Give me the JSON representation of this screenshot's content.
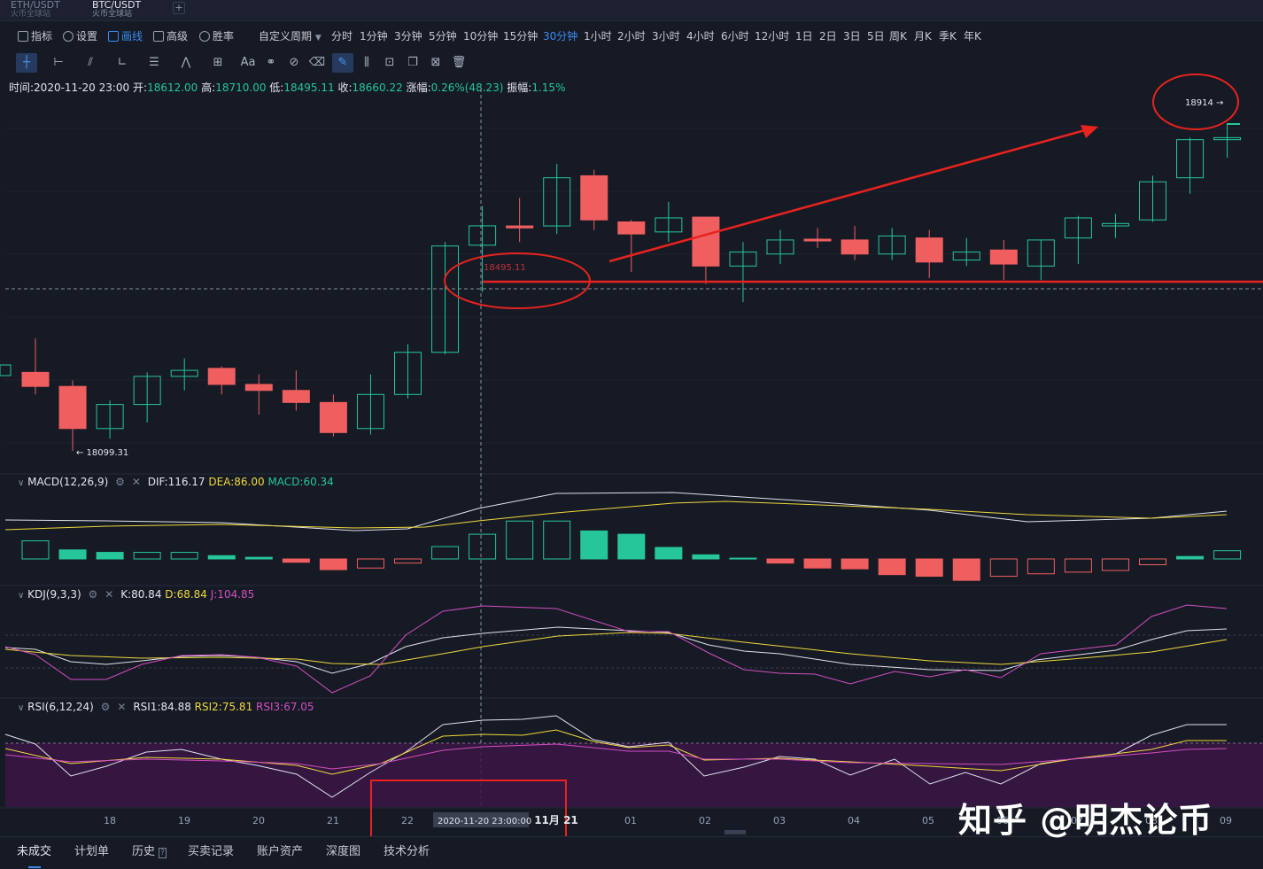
{
  "tabs": [
    {
      "pair": "ETH/USDT",
      "exchange": "火币全球站",
      "active": false
    },
    {
      "pair": "BTC/USDT",
      "exchange": "火币全球站",
      "active": true
    }
  ],
  "tab_add": "+",
  "toolbar": {
    "indicators": "指标",
    "settings": "设置",
    "draw": "画线",
    "advanced": "高级",
    "win_rate": "胜率",
    "custom_period": "自定义周期"
  },
  "periods": [
    "分时",
    "1分钟",
    "3分钟",
    "5分钟",
    "10分钟",
    "15分钟",
    "30分钟",
    "1小时",
    "2小时",
    "3小时",
    "4小时",
    "6小时",
    "12小时",
    "1日",
    "2日",
    "3日",
    "5日",
    "周K",
    "月K",
    "季K",
    "年K"
  ],
  "active_period": "30分钟",
  "ohlc_info": {
    "time_label": "时间:",
    "time": "2020-11-20 23:00",
    "open_label": "开:",
    "open": "18612.00",
    "high_label": "高:",
    "high": "18710.00",
    "low_label": "低:",
    "low": "18495.11",
    "close_label": "收:",
    "close": "18660.22",
    "change_label": "涨幅:",
    "change": "0.26%(48.23)",
    "amplitude_label": "振幅:",
    "amplitude": "1.15%"
  },
  "annotations": {
    "high_marker": "18914 →",
    "low_marker": "← 18099.31",
    "crosshair_price": "18495.11",
    "crosshair_time": "2020-11-20 23:00:00"
  },
  "macd": {
    "name": "MACD(12,26,9)",
    "dif": "DIF:116.17",
    "dea": "DEA:86.00",
    "macd": "MACD:60.34"
  },
  "kdj": {
    "name": "KDJ(9,3,3)",
    "k": "K:80.84",
    "d": "D:68.84",
    "j": "J:104.85"
  },
  "rsi": {
    "name": "RSI(6,12,24)",
    "rsi1": "RSI1:84.88",
    "rsi2": "RSI2:75.81",
    "rsi3": "RSI3:67.05"
  },
  "x_axis_labels": [
    "18",
    "19",
    "20",
    "21",
    "22",
    "11月 21",
    "01",
    "02",
    "03",
    "04",
    "05",
    "06",
    "07",
    "08",
    "09"
  ],
  "bottom_tabs": [
    "未成交",
    "计划单",
    "历史",
    "买卖记录",
    "账户资产",
    "深度图",
    "技术分析"
  ],
  "watermark": "知乎 @明杰论币",
  "colors": {
    "up": "#26c69a",
    "down": "#ef5f5f",
    "accent": "#3c8cf0",
    "annotation": "#e8231f",
    "rsi_band": "#3a1645"
  },
  "chart_data": {
    "type": "candlestick",
    "candles": [
      {
        "o": 18295,
        "h": 18380,
        "l": 18240,
        "c": 18260
      },
      {
        "o": 18260,
        "h": 18275,
        "l": 18099.31,
        "c": 18155
      },
      {
        "o": 18155,
        "h": 18225,
        "l": 18130,
        "c": 18215
      },
      {
        "o": 18215,
        "h": 18295,
        "l": 18170,
        "c": 18285
      },
      {
        "o": 18285,
        "h": 18330,
        "l": 18250,
        "c": 18300
      },
      {
        "o": 18305,
        "h": 18310,
        "l": 18240,
        "c": 18265
      },
      {
        "o": 18265,
        "h": 18290,
        "l": 18190,
        "c": 18250
      },
      {
        "o": 18250,
        "h": 18300,
        "l": 18200,
        "c": 18220
      },
      {
        "o": 18220,
        "h": 18240,
        "l": 18135,
        "c": 18145
      },
      {
        "o": 18155,
        "h": 18290,
        "l": 18140,
        "c": 18240
      },
      {
        "o": 18240,
        "h": 18365,
        "l": 18230,
        "c": 18345
      },
      {
        "o": 18345,
        "h": 18620,
        "l": 18340,
        "c": 18610
      },
      {
        "o": 18612,
        "h": 18710,
        "l": 18495.11,
        "c": 18660.22
      },
      {
        "o": 18660,
        "h": 18730,
        "l": 18620,
        "c": 18655
      },
      {
        "o": 18660,
        "h": 18815,
        "l": 18640,
        "c": 18780
      },
      {
        "o": 18785,
        "h": 18800,
        "l": 18650,
        "c": 18675
      },
      {
        "o": 18670,
        "h": 18675,
        "l": 18545,
        "c": 18640
      },
      {
        "o": 18645,
        "h": 18720,
        "l": 18620,
        "c": 18680
      },
      {
        "o": 18682,
        "h": 18682,
        "l": 18515,
        "c": 18560
      },
      {
        "o": 18560,
        "h": 18620,
        "l": 18470,
        "c": 18595
      },
      {
        "o": 18590,
        "h": 18650,
        "l": 18565,
        "c": 18625
      },
      {
        "o": 18627,
        "h": 18655,
        "l": 18605,
        "c": 18625
      },
      {
        "o": 18625,
        "h": 18660,
        "l": 18575,
        "c": 18590
      },
      {
        "o": 18590,
        "h": 18655,
        "l": 18575,
        "c": 18635
      },
      {
        "o": 18630,
        "h": 18650,
        "l": 18530,
        "c": 18570
      },
      {
        "o": 18575,
        "h": 18630,
        "l": 18560,
        "c": 18595
      },
      {
        "o": 18600,
        "h": 18625,
        "l": 18525,
        "c": 18565
      },
      {
        "o": 18560,
        "h": 18625,
        "l": 18525,
        "c": 18625
      },
      {
        "o": 18630,
        "h": 18685,
        "l": 18565,
        "c": 18680
      },
      {
        "o": 18660,
        "h": 18690,
        "l": 18630,
        "c": 18666
      },
      {
        "o": 18675,
        "h": 18785,
        "l": 18670,
        "c": 18770
      },
      {
        "o": 18780,
        "h": 18880,
        "l": 18740,
        "c": 18875
      },
      {
        "o": 18875,
        "h": 18914,
        "l": 18830,
        "c": 18880
      }
    ],
    "horizontal_line_price": 18520,
    "macd_hist": [
      22,
      11,
      8,
      8,
      8,
      4,
      2,
      -4,
      -13,
      -11,
      -5,
      15,
      30,
      46,
      46,
      34,
      30,
      14,
      5,
      1,
      -5,
      -11,
      -12,
      -19,
      -21,
      -26,
      -21,
      -18,
      -16,
      -14,
      -7,
      3,
      10
    ]
  }
}
